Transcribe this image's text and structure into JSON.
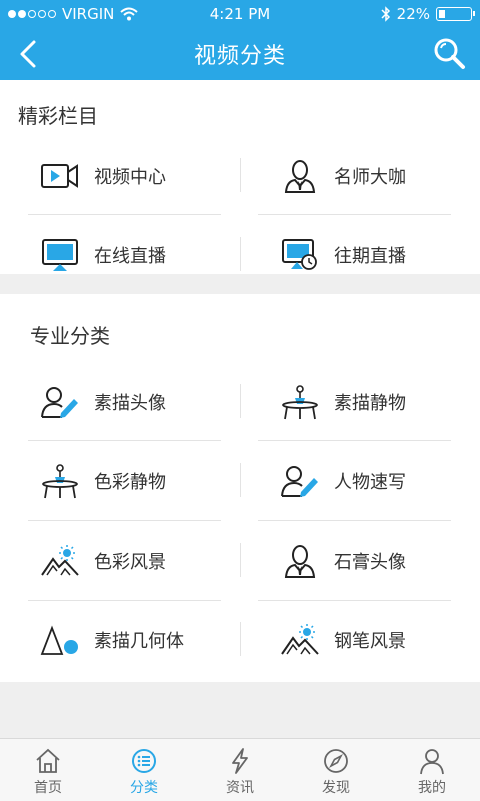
{
  "status_bar": {
    "carrier": "VIRGIN",
    "time": "4:21 PM",
    "battery": "22%",
    "battery_level": 0.22
  },
  "navbar": {
    "title": "视频分类"
  },
  "featured": {
    "title": "精彩栏目",
    "items": [
      {
        "label": "视频中心",
        "icon": "video-camera-icon"
      },
      {
        "label": "名师大咖",
        "icon": "teacher-icon"
      },
      {
        "label": "在线直播",
        "icon": "screen-live-icon"
      },
      {
        "label": "往期直播",
        "icon": "screen-history-icon"
      }
    ]
  },
  "categories": {
    "title": "专业分类",
    "items": [
      {
        "label": "素描头像",
        "icon": "portrait-pencil-icon"
      },
      {
        "label": "素描静物",
        "icon": "still-life-icon"
      },
      {
        "label": "色彩静物",
        "icon": "still-life-icon"
      },
      {
        "label": "人物速写",
        "icon": "portrait-pencil-icon"
      },
      {
        "label": "色彩风景",
        "icon": "landscape-icon"
      },
      {
        "label": "石膏头像",
        "icon": "bust-icon"
      },
      {
        "label": "素描几何体",
        "icon": "geometry-icon"
      },
      {
        "label": "钢笔风景",
        "icon": "landscape-icon"
      }
    ]
  },
  "tabbar": {
    "items": [
      {
        "label": "首页",
        "icon": "home-icon"
      },
      {
        "label": "分类",
        "icon": "category-icon",
        "active": true
      },
      {
        "label": "资讯",
        "icon": "lightning-icon"
      },
      {
        "label": "发现",
        "icon": "compass-icon"
      },
      {
        "label": "我的",
        "icon": "user-icon"
      }
    ]
  },
  "colors": {
    "accent": "#29a7e6",
    "icon_dark": "#333333",
    "icon_blue": "#29a7e6"
  }
}
